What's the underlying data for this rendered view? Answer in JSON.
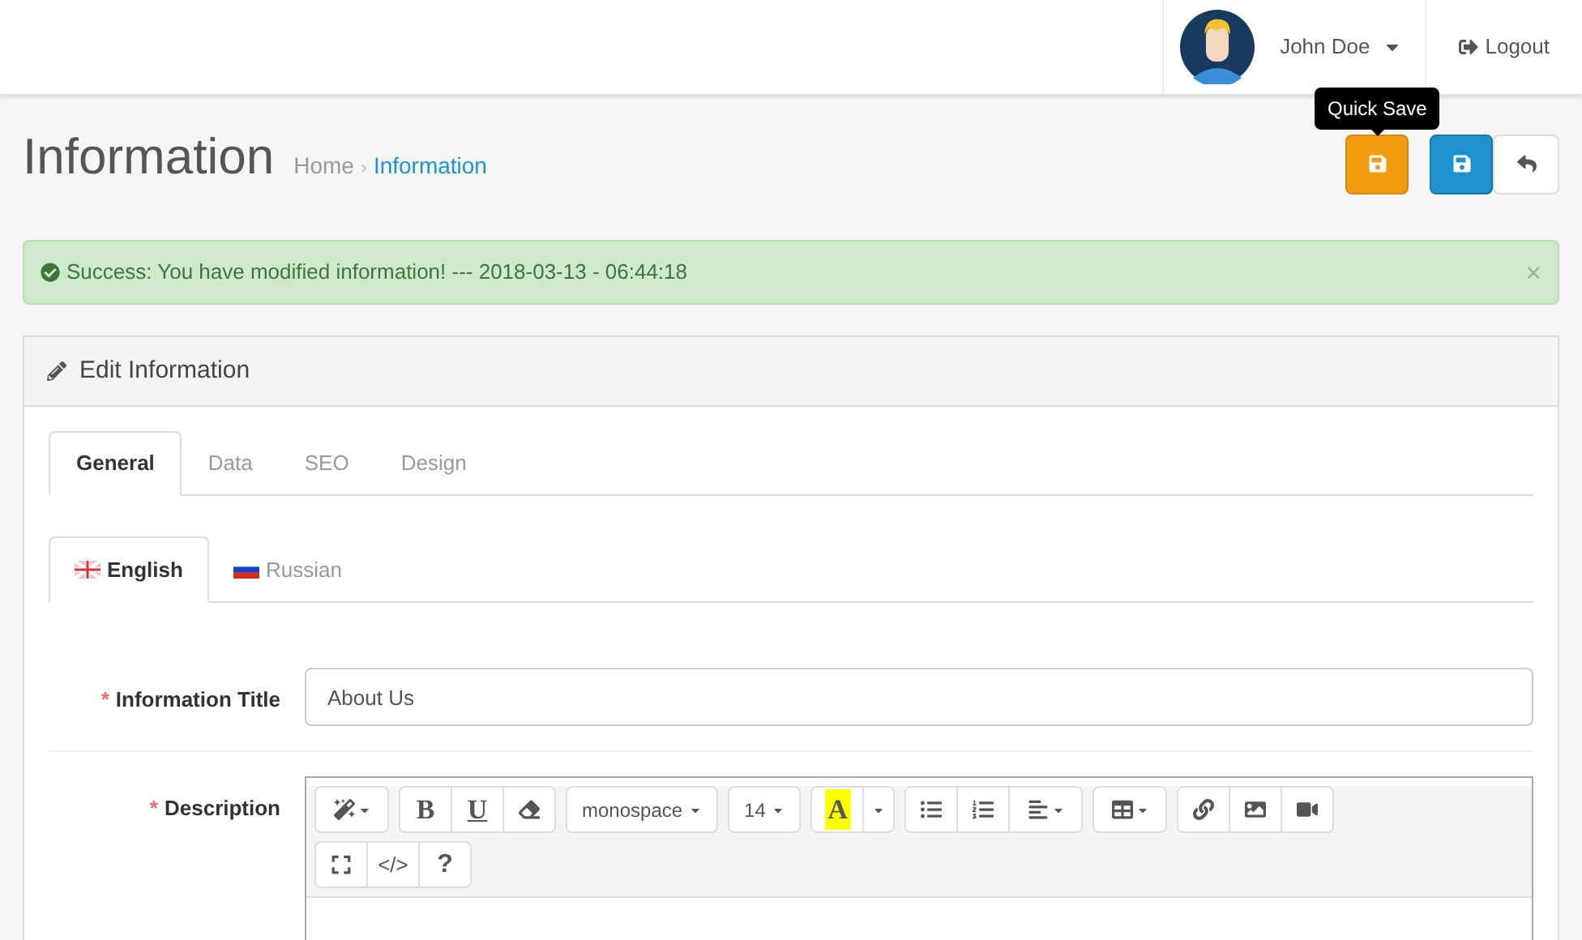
{
  "header": {
    "user": "John Doe",
    "logout": "Logout"
  },
  "page": {
    "title": "Information",
    "separator": "›",
    "breadcrumb": [
      {
        "label": "Home",
        "selected": false
      },
      {
        "label": "Information",
        "selected": true
      }
    ]
  },
  "tooltip": "Quick Save",
  "actions": [
    {
      "kind": "quick_save"
    },
    {
      "kind": "save"
    },
    {
      "kind": "back"
    }
  ],
  "alert": {
    "text": "Success: You have modified information! --- 2018-03-13 - 06:44:18",
    "close": "×"
  },
  "panel": {
    "title": "Edit Information"
  },
  "tabs": [
    {
      "label": "General",
      "selected": true
    },
    {
      "label": "Data",
      "selected": false
    },
    {
      "label": "SEO",
      "selected": false
    },
    {
      "label": "Design",
      "selected": false
    }
  ],
  "language_tabs": [
    {
      "label": "English",
      "selected": true
    },
    {
      "label": "Russian",
      "selected": false
    }
  ],
  "form": [
    {
      "kind": "input",
      "label": "Information Title",
      "required_mark": "*",
      "value": "About Us"
    },
    {
      "kind": "editor",
      "label": "Description",
      "required_mark": "*"
    }
  ],
  "toolbar": [
    [
      [
        {
          "kind": "magic"
        }
      ],
      [
        {
          "kind": "bold",
          "text": "B"
        },
        {
          "kind": "underline",
          "text": "U"
        },
        {
          "kind": "eraser"
        }
      ],
      [
        {
          "kind": "select",
          "text": "monospace"
        }
      ],
      [
        {
          "kind": "select",
          "text": "14"
        }
      ],
      [
        {
          "kind": "highlight",
          "text": "A"
        },
        {
          "kind": "dropdown"
        }
      ],
      [
        {
          "kind": "bullets"
        },
        {
          "kind": "numbers"
        },
        {
          "kind": "align"
        }
      ],
      [
        {
          "kind": "table"
        }
      ],
      [
        {
          "kind": "link"
        },
        {
          "kind": "image"
        },
        {
          "kind": "video"
        }
      ]
    ],
    [
      [
        {
          "kind": "expand"
        },
        {
          "kind": "code",
          "text": "</>"
        },
        {
          "kind": "help",
          "text": "?"
        }
      ]
    ]
  ]
}
